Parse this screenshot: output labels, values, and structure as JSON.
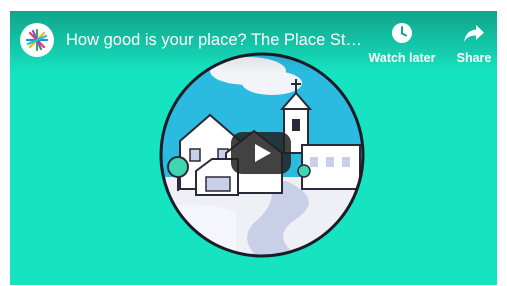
{
  "video": {
    "title": "How good is your place? The Place Sta...",
    "background_color": "#16e3c0"
  },
  "actions": {
    "watch_later_label": "Watch later",
    "share_label": "Share"
  },
  "icons": {
    "channel_logo": "starburst-logo-icon",
    "watch_later": "clock-icon",
    "share": "share-arrow-icon",
    "play": "play-icon"
  }
}
